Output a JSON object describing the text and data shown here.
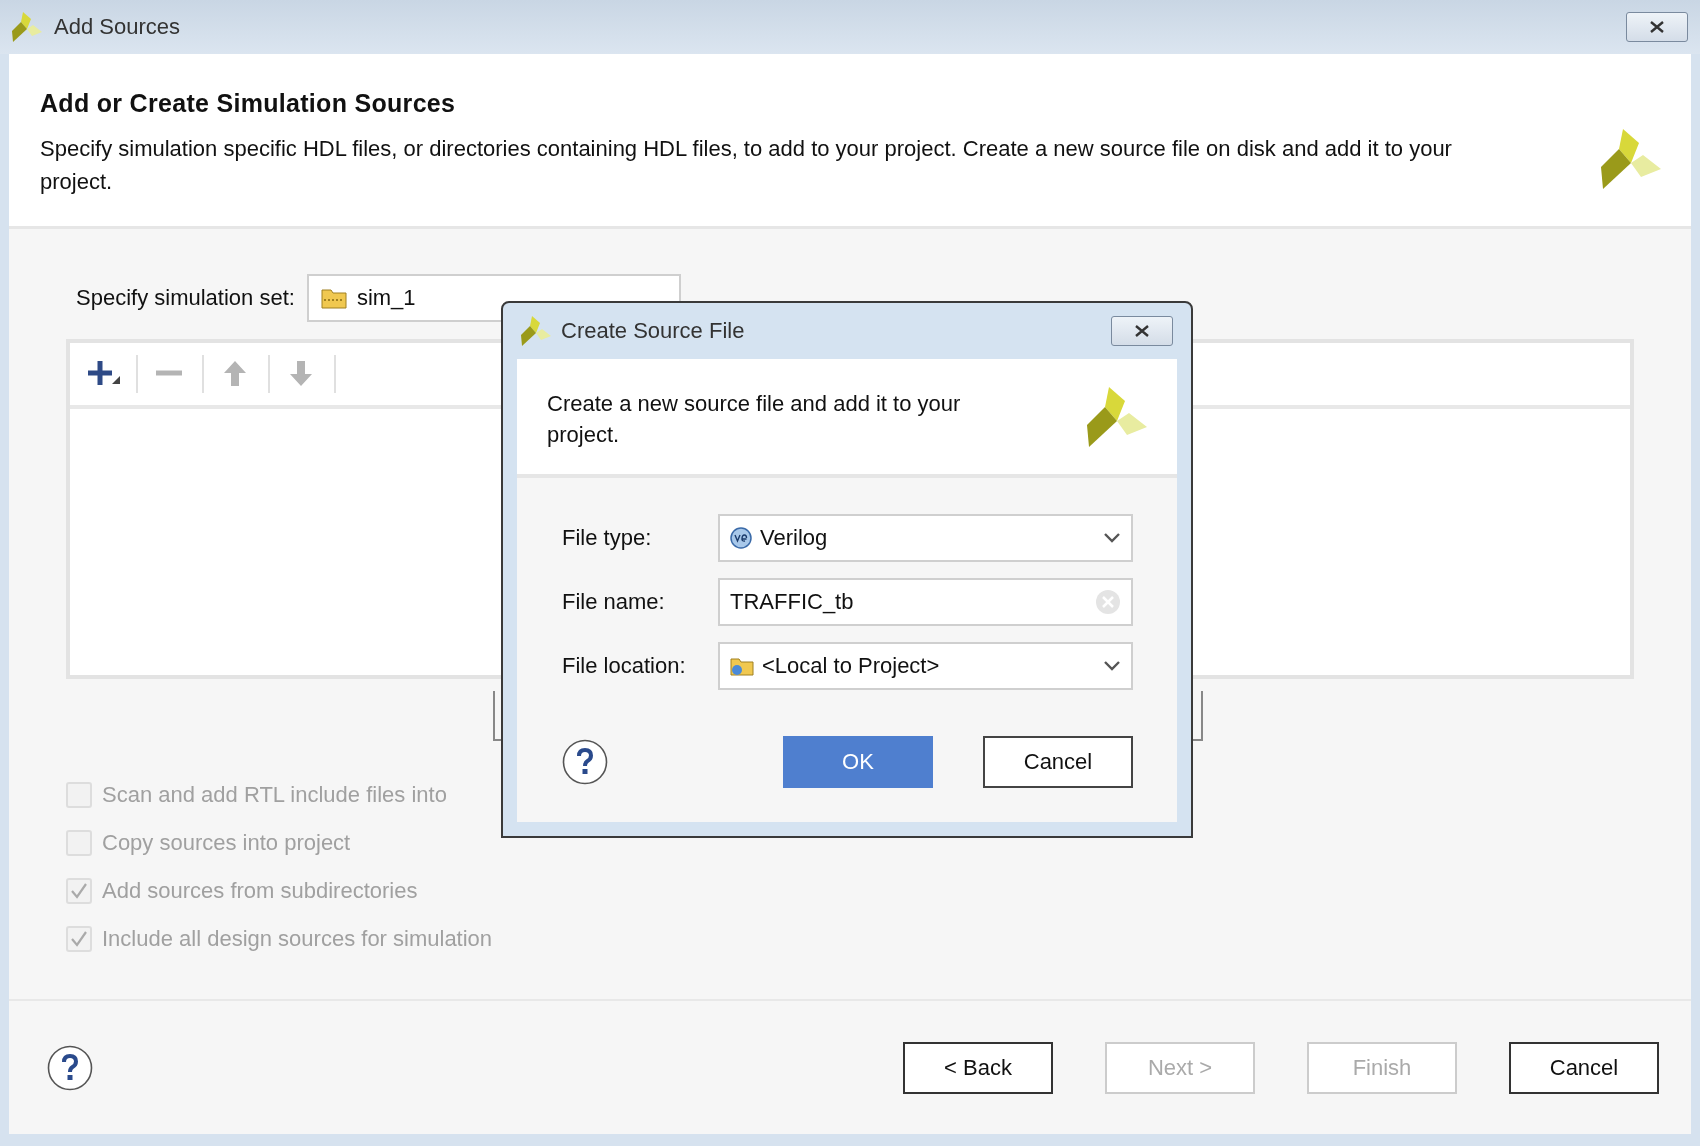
{
  "window": {
    "title": "Add Sources"
  },
  "header": {
    "title": "Add or Create Simulation Sources",
    "description": "Specify simulation specific HDL files, or directories containing HDL files, to add to your project. Create a new source file on disk and add it to your project."
  },
  "simulation_set": {
    "label": "Specify simulation set:",
    "value": "sim_1"
  },
  "toolbar": [
    {
      "kind": "add",
      "disabled": false
    },
    {
      "kind": "remove",
      "disabled": true
    },
    {
      "kind": "up",
      "disabled": true
    },
    {
      "kind": "down",
      "disabled": true
    }
  ],
  "options": [
    {
      "label": "Scan and add RTL include files into",
      "checked": false,
      "disabled": true
    },
    {
      "label": "Copy sources into project",
      "checked": false,
      "disabled": true
    },
    {
      "label": "Add sources from subdirectories",
      "checked": true,
      "disabled": true
    },
    {
      "label": "Include all design sources for simulation",
      "checked": true,
      "disabled": true
    }
  ],
  "buttons": [
    {
      "label": "< Back",
      "disabled": false
    },
    {
      "label": "Next >",
      "disabled": true
    },
    {
      "label": "Finish",
      "disabled": true
    },
    {
      "label": "Cancel",
      "disabled": false
    }
  ],
  "dialog": {
    "title": "Create Source File",
    "description": "Create a new source file and add it to your project.",
    "fields": [
      {
        "kind": "language",
        "label": "File type:",
        "value": "Verilog"
      },
      {
        "kind": "text",
        "label": "File name:",
        "value": "TRAFFIC_tb"
      },
      {
        "kind": "folder",
        "label": "File location:",
        "value": "<Local to Project>"
      }
    ],
    "buttons": [
      {
        "label": "OK",
        "primary": true
      },
      {
        "label": "Cancel",
        "primary": false
      }
    ]
  }
}
